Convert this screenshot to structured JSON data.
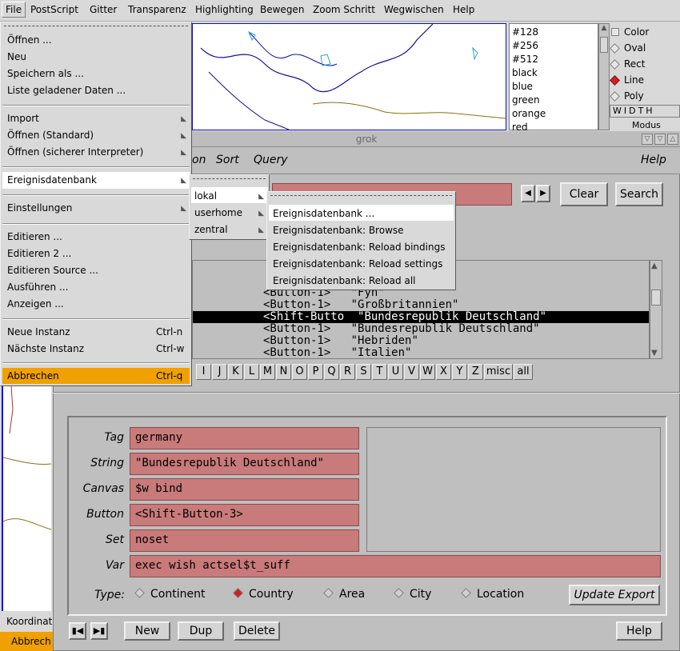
{
  "menubar": {
    "items": [
      "File",
      "PostScript",
      "Gitter",
      "Transparenz",
      "Highlighting",
      "Bewegen",
      "Zoom Schritt",
      "Wegwischen",
      "Help"
    ]
  },
  "colorlist": [
    "#128",
    "#256",
    "#512",
    "black",
    "blue",
    "green",
    "orange",
    "red"
  ],
  "shapes": {
    "color_label": "Color",
    "items": [
      "Oval",
      "Rect",
      "Line",
      "Poly"
    ],
    "selected": "Line",
    "width_label": "WIDTH",
    "modus_label": "Modus"
  },
  "grok": {
    "title": "grok",
    "menu_frag": "on",
    "menu_sort": "Sort",
    "menu_query": "Query",
    "menu_help": "Help",
    "clear": "Clear",
    "search": "Search",
    "list": [
      {
        "btn": "<Button-1>",
        "val": "\"Fyn\""
      },
      {
        "btn": "<Button-1>",
        "val": "\"Großbritannien\""
      },
      {
        "btn": "<Shift-Butto",
        "val": "\"Bundesrepublik Deutschland\""
      },
      {
        "btn": "<Button-1>",
        "val": "\"Bundesrepublik Deutschland\""
      },
      {
        "btn": "<Button-1>",
        "val": "\"Hebriden\""
      },
      {
        "btn": "<Button-1>",
        "val": "\"Italien\""
      }
    ],
    "letters": [
      "I",
      "J",
      "K",
      "L",
      "M",
      "N",
      "O",
      "P",
      "Q",
      "R",
      "S",
      "T",
      "U",
      "V",
      "W",
      "X",
      "Y",
      "Z",
      "misc",
      "all"
    ],
    "fields": {
      "tag_label": "Tag",
      "tag": "germany",
      "string_label": "String",
      "string": "\"Bundesrepublik Deutschland\"",
      "canvas_label": "Canvas",
      "canvas": "$w bind",
      "button_label": "Button",
      "button": "<Shift-Button-3>",
      "set_label": "Set",
      "set": "noset",
      "var_label": "Var",
      "var": "exec wish actsel$t_suff"
    },
    "type_label": "Type:",
    "types": [
      "Continent",
      "Country",
      "Area",
      "City",
      "Location"
    ],
    "type_selected": "Country",
    "update_export": "Update Export",
    "new": "New",
    "dup": "Dup",
    "delete": "Delete",
    "help": "Help"
  },
  "filemenu": {
    "items": [
      {
        "label": "Öffnen ..."
      },
      {
        "label": "Neu"
      },
      {
        "label": "Speichern als ..."
      },
      {
        "label": "Liste geladener Daten ..."
      },
      {
        "label": "Import"
      },
      {
        "label": "Öffnen (Standard)"
      },
      {
        "label": "Öffnen (sicherer Interpreter)"
      },
      {
        "label": "Ereignisdatenbank"
      },
      {
        "label": "Einstellungen"
      },
      {
        "label": "Editieren ..."
      },
      {
        "label": "Editieren 2 ..."
      },
      {
        "label": "Editieren Source ..."
      },
      {
        "label": "Ausführen ..."
      },
      {
        "label": "Anzeigen ..."
      },
      {
        "label": "Neue Instanz",
        "shortcut": "Ctrl-n"
      },
      {
        "label": "Nächste Instanz",
        "shortcut": "Ctrl-w"
      },
      {
        "label": "Abbrechen",
        "shortcut": "Ctrl-q"
      }
    ]
  },
  "submenu1": [
    "lokal",
    "userhome",
    "zentral"
  ],
  "submenu2": [
    "Ereignisdatenbank ...",
    "Ereignisdatenbank: Browse",
    "Ereignisdatenbank: Reload bindings",
    "Ereignisdatenbank: Reload settings",
    "Ereignisdatenbank: Reload all"
  ],
  "status": {
    "koordinat": "Koordinat",
    "abbrech": "Abbrech"
  }
}
